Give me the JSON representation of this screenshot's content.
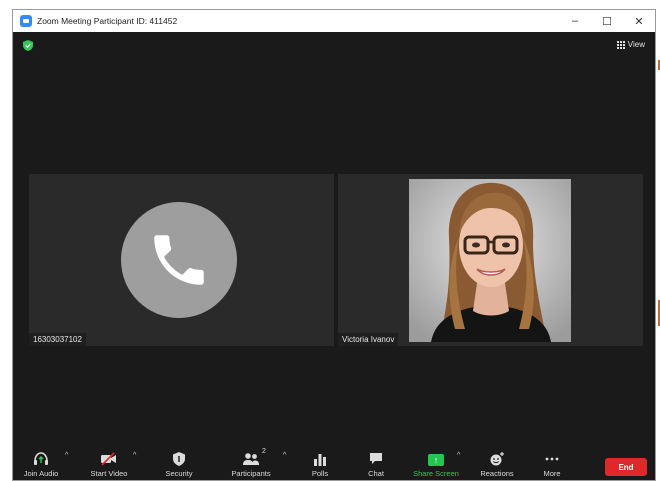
{
  "window": {
    "title": "Zoom Meeting Participant ID: 411452",
    "controls": [
      "–",
      "☐",
      "✕"
    ]
  },
  "meeting": {
    "view_label": "View"
  },
  "participants": [
    {
      "name": "16303037102",
      "type": "phone"
    },
    {
      "name": "Victoria Ivanov",
      "type": "video"
    }
  ],
  "toolbar": {
    "join_audio": "Join Audio",
    "start_video": "Start Video",
    "security": "Security",
    "participants": "Participants",
    "participants_count": "2",
    "polls": "Polls",
    "chat": "Chat",
    "share_screen": "Share Screen",
    "reactions": "Reactions",
    "more": "More",
    "end": "End"
  },
  "colors": {
    "accent": "#2d8cff",
    "end": "#e02828",
    "share": "#23c552",
    "security_shield": "#34c759"
  },
  "icons": {
    "app": "zoom-icon",
    "shield": "shield-check-icon",
    "view": "grid-icon",
    "phone": "phone-icon"
  }
}
